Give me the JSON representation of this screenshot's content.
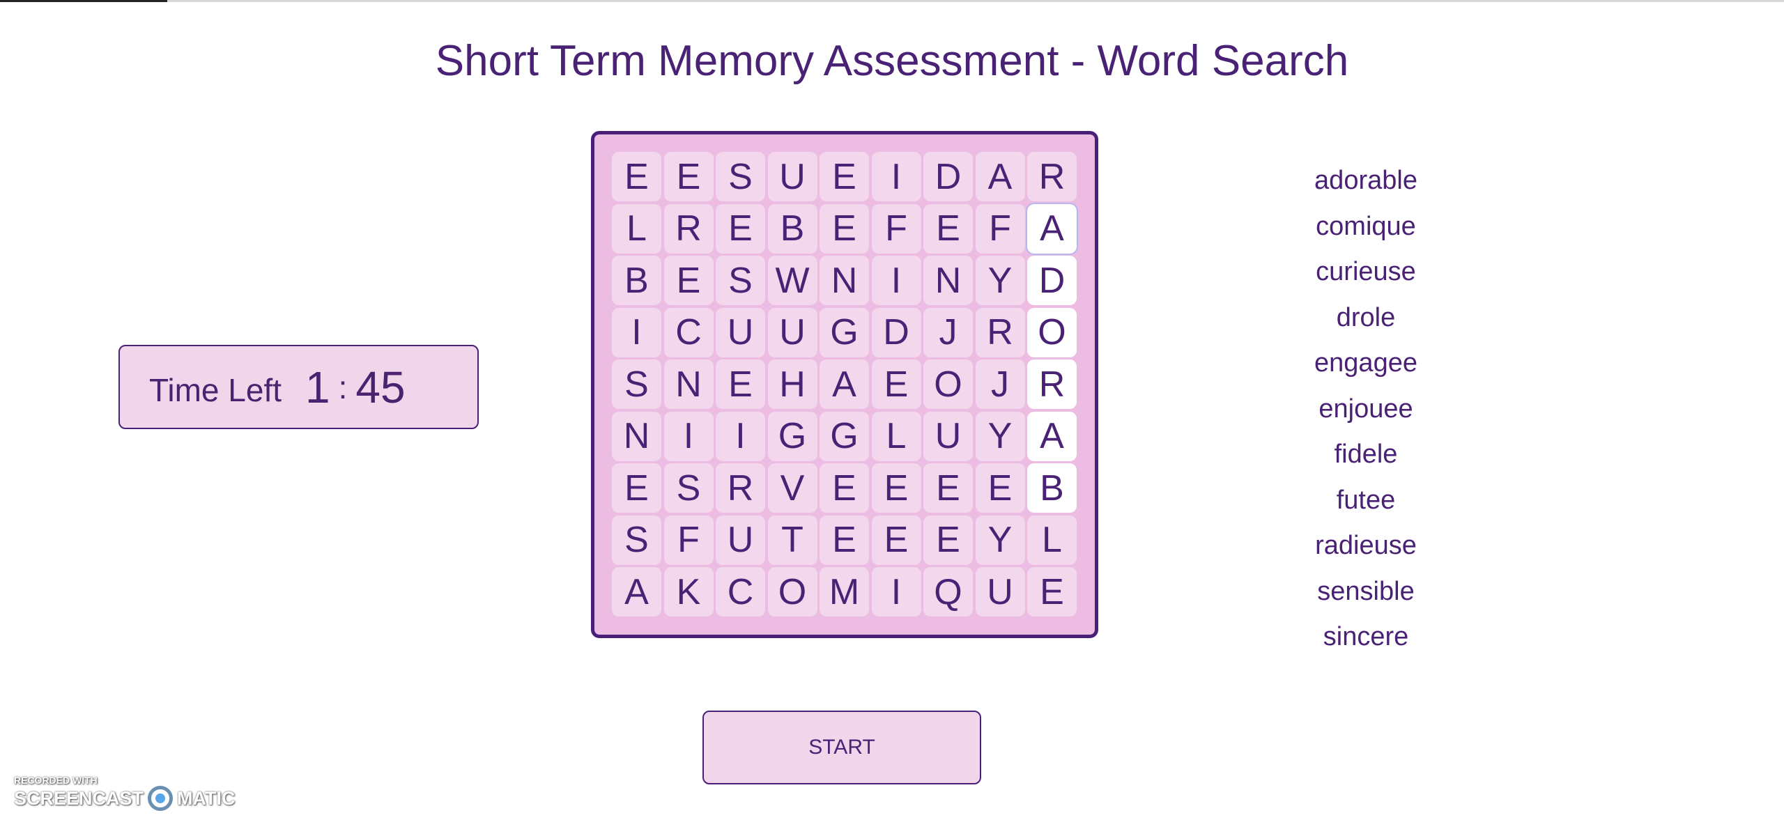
{
  "title": "Short Term Memory Assessment - Word Search",
  "timer": {
    "label": "Time Left",
    "minutes": "1",
    "separator": ":",
    "seconds": "45"
  },
  "grid": [
    [
      "E",
      "E",
      "S",
      "U",
      "E",
      "I",
      "D",
      "A",
      "R"
    ],
    [
      "L",
      "R",
      "E",
      "B",
      "E",
      "F",
      "E",
      "F",
      "A"
    ],
    [
      "B",
      "E",
      "S",
      "W",
      "N",
      "I",
      "N",
      "Y",
      "D"
    ],
    [
      "I",
      "C",
      "U",
      "U",
      "G",
      "D",
      "J",
      "R",
      "O"
    ],
    [
      "S",
      "N",
      "E",
      "H",
      "A",
      "E",
      "O",
      "J",
      "R"
    ],
    [
      "N",
      "I",
      "I",
      "G",
      "G",
      "L",
      "U",
      "Y",
      "A"
    ],
    [
      "E",
      "S",
      "R",
      "V",
      "E",
      "E",
      "E",
      "E",
      "B"
    ],
    [
      "S",
      "F",
      "U",
      "T",
      "E",
      "E",
      "E",
      "Y",
      "L"
    ],
    [
      "A",
      "K",
      "C",
      "O",
      "M",
      "I",
      "Q",
      "U",
      "E"
    ]
  ],
  "selected_cells": [
    [
      1,
      8
    ],
    [
      2,
      8
    ],
    [
      3,
      8
    ],
    [
      4,
      8
    ],
    [
      5,
      8
    ],
    [
      6,
      8
    ]
  ],
  "words": [
    "adorable",
    "comique",
    "curieuse",
    "drole",
    "engagee",
    "enjouee",
    "fidele",
    "futee",
    "radieuse",
    "sensible",
    "sincere"
  ],
  "start_label": "START",
  "watermark": {
    "line1": "RECORDED WITH",
    "line2a": "SCREENCAST",
    "line2b": "MATIC"
  }
}
